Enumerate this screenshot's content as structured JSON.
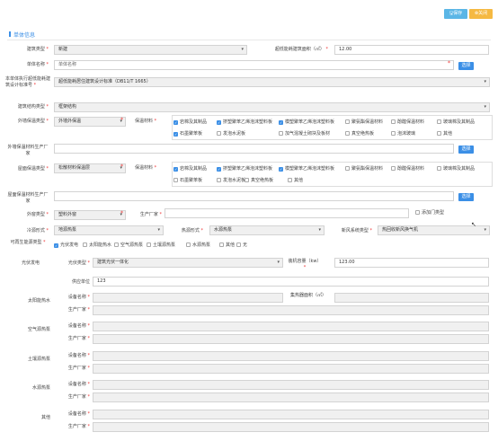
{
  "toolbar": {
    "save": "保存",
    "close": "关闭"
  },
  "section_title": "单体信息",
  "building_type": {
    "label": "建筑类型",
    "value": "新建"
  },
  "area": {
    "label": "超低能耗建筑面积（㎡）",
    "value": "12.00"
  },
  "unit_name": {
    "label": "单体名称",
    "placeholder": "单体名称",
    "select": "选择"
  },
  "standard": {
    "label": "本单体执行超低能耗建筑设计标准号",
    "value": "超低能耗居住建筑设计标准（DB11/T 1665）"
  },
  "structure": {
    "label": "建筑结构类型",
    "value": "框架结构"
  },
  "wall": {
    "label": "外墙保温类型",
    "value": "外墙外保温",
    "mat_label": "保温材料",
    "materials": [
      {
        "t": "岩棉及其制品",
        "on": true
      },
      {
        "t": "挤塑聚苯乙烯泡沫塑料板",
        "on": true
      },
      {
        "t": "模塑聚苯乙烯泡沫塑料板",
        "on": true
      },
      {
        "t": "聚氨酯保温材料",
        "on": false
      },
      {
        "t": "酚醛保温材料",
        "on": false
      },
      {
        "t": "玻璃棉及其制品",
        "on": false
      },
      {
        "t": "石墨聚苯板",
        "on": true
      },
      {
        "t": "发泡水泥板",
        "on": false
      },
      {
        "t": "加气混凝土砌块及板材",
        "on": false
      },
      {
        "t": "真空绝热板",
        "on": false
      },
      {
        "t": "泡沫玻璃",
        "on": false
      },
      {
        "t": "其他",
        "on": false
      }
    ]
  },
  "wall_mfr": {
    "label": "外墙保温材料生产厂家",
    "select": "选择"
  },
  "roof": {
    "label": "屋面保温类型",
    "value": "松散材料保温层",
    "mat_label": "保温材料",
    "materials": [
      {
        "t": "岩棉及其制品",
        "on": true
      },
      {
        "t": "挤塑聚苯乙烯泡沫塑料板",
        "on": true
      },
      {
        "t": "模塑聚苯乙烯泡沫塑料板",
        "on": true
      },
      {
        "t": "聚氨酯保温材料",
        "on": false
      },
      {
        "t": "酚醛保温材料",
        "on": false
      },
      {
        "t": "玻璃棉及其制品",
        "on": false
      },
      {
        "t": "石墨聚苯板",
        "on": false
      },
      {
        "t": "发泡水泥板",
        "on": false
      },
      {
        "t": "真空绝热板",
        "on": false
      },
      {
        "t": "其他",
        "on": false
      }
    ]
  },
  "roof_mfr": {
    "label": "屋面保温材料生产厂家",
    "select": "选择"
  },
  "window": {
    "label": "外窗类型",
    "value": "塑料外窗",
    "mfr_label": "生产厂家",
    "add": "添加门类型"
  },
  "cold": {
    "label": "冷源形式",
    "value": "地源热泵"
  },
  "heat": {
    "label": "热源形式",
    "value": "水源热泵"
  },
  "fresh": {
    "label": "新风系统类型",
    "value": "热回收新风换气机"
  },
  "renew": {
    "label": "可再生能源类型",
    "options": [
      {
        "t": "光伏发电",
        "on": true
      },
      {
        "t": "太阳能热水",
        "on": false
      },
      {
        "t": "空气源热泵",
        "on": false
      },
      {
        "t": "土壤源热泵",
        "on": false
      },
      {
        "t": "水源热泵",
        "on": false
      },
      {
        "t": "其他",
        "on": false
      },
      {
        "t": "无",
        "on": false
      }
    ]
  },
  "pv": {
    "label": "光伏发电",
    "type_label": "光伏类型",
    "type_value": "建筑光伏一体化",
    "cap_label": "装机容量（kw）",
    "cap_value": "123.00",
    "supplier_label": "供应单位",
    "supplier_value": "123"
  },
  "sub_rows": [
    {
      "label": "太阳能热水",
      "f1": "设备名称",
      "f2": "生产厂家",
      "extra": "集热器面积（㎡）"
    },
    {
      "label": "空气源热泵",
      "f1": "设备名称",
      "f2": "生产厂家"
    },
    {
      "label": "土壤源热泵",
      "f1": "设备名称",
      "f2": "生产厂家"
    },
    {
      "label": "水源热泵",
      "f1": "设备名称",
      "f2": "生产厂家"
    },
    {
      "label": "其他",
      "f1": "设备名称",
      "f2": "生产厂家"
    }
  ]
}
